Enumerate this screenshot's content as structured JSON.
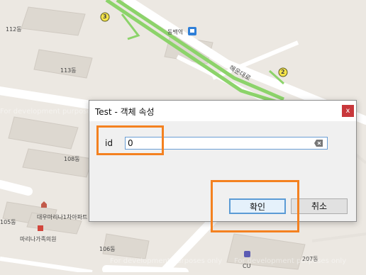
{
  "map": {
    "labels": [
      "112동",
      "113동",
      "108동",
      "105동",
      "106동",
      "207동",
      "대우마리나1차아파트",
      "마리나가족의원",
      "동백역",
      "해운대로",
      "CU"
    ],
    "route_markers": [
      "3",
      "2"
    ],
    "watermark": "For development purposes only"
  },
  "dialog": {
    "title": "Test - 객체 속성",
    "close_label": "x",
    "field_label": "id",
    "field_value": "0",
    "ok_label": "확인",
    "cancel_label": "취소"
  },
  "colors": {
    "highlight": "#f48120",
    "close_button": "#c8373b",
    "ok_border": "#5b9bd5"
  }
}
